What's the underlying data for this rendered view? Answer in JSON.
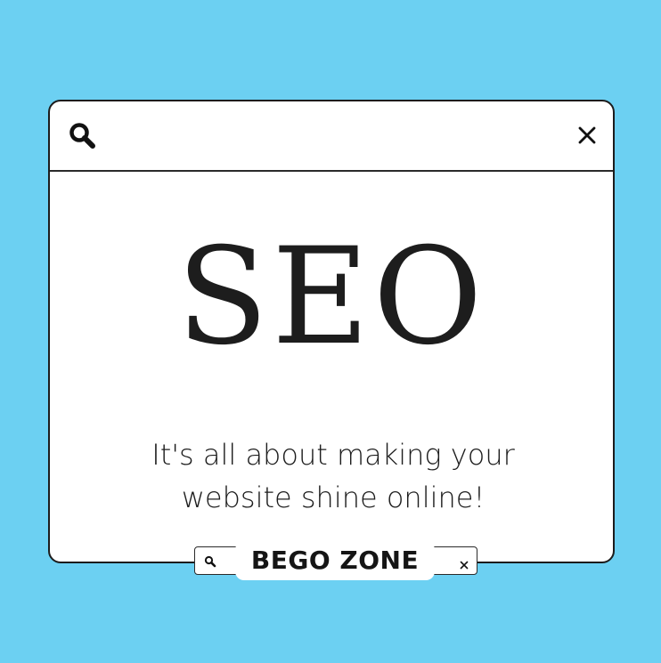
{
  "window": {
    "search_icon": "search-icon",
    "close_icon": "close-icon"
  },
  "main": {
    "headline": "SEO",
    "tagline": "It's all about making your website shine online!"
  },
  "brand_bar": {
    "label": "BEGO ZONE",
    "search_icon": "search-icon",
    "close_icon": "close-icon"
  },
  "colors": {
    "background": "#6cd0f2",
    "panel": "#ffffff",
    "ink": "#1d1d1d"
  }
}
